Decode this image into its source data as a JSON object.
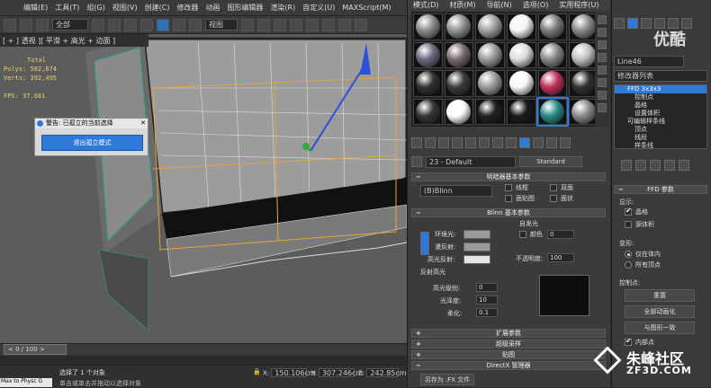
{
  "menu": {
    "logo": "3",
    "items": [
      "编辑(E)",
      "工具(T)",
      "组(G)",
      "视图(V)",
      "创建(C)",
      "修改器",
      "动画",
      "图形编辑器",
      "渲染(R)",
      "自定义(U)",
      "MAXScript(M)"
    ]
  },
  "toolbar": {
    "filter": "全部",
    "viewref": "视图"
  },
  "viewport": {
    "label": "[ + ] 透视 ][ 平滑 + 高光 + 边面 ]"
  },
  "stats": {
    "total": "Total",
    "polys": "Polys: 582,674",
    "verts": "Verts: 392,495",
    "fps": "FPS: 37.681"
  },
  "warning": {
    "title": "警告: 已孤立的当前选择",
    "button": "退出孤立模式"
  },
  "timeline": {
    "frame": "0 / 100"
  },
  "status": {
    "script": "Max to Physc G",
    "selected": "选择了 1 个对象",
    "hint": "单击或单击并拖动以选择对象",
    "x": "150.106cm",
    "y": "307.246cm",
    "z": "242.85cm"
  },
  "material_editor": {
    "menu": [
      "模式(D)",
      "材质(M)",
      "导航(N)",
      "选项(O)",
      "实用程序(U)"
    ],
    "name": "23 - Default",
    "type": "Standard",
    "shader_roll": "明暗器基本参数",
    "shader": "(B)Blinn",
    "shader_opts": [
      "线框",
      "双面",
      "面贴图",
      "面状"
    ],
    "blinn_roll": "Blinn 基本参数",
    "self_illum": "自发光",
    "color_label": "颜色",
    "color_val": "0",
    "ambient": "环境光:",
    "diffuse": "漫反射:",
    "specular": "高光反射:",
    "opacity_label": "不透明度:",
    "opacity": "100",
    "spec_hl": "反射高光",
    "spec_level_label": "高光级别:",
    "spec_level": "0",
    "gloss_label": "光泽度:",
    "gloss": "10",
    "soften_label": "柔化:",
    "soften": "0.1",
    "rollouts": [
      "扩展参数",
      "超级采样",
      "贴图",
      "DirectX 管理器"
    ],
    "save_fx": "另存为 .FX 文件",
    "sphere_colors": [
      "#8a8a8a",
      "#909090",
      "#a0a0a0",
      "#f4f4f4",
      "#7a7a7a",
      "#888888",
      "#6a6a80",
      "#7a6a70",
      "#9a9a9a",
      "#dddddd",
      "#888888",
      "#c0c0c0",
      "#303030",
      "#3a3a3a",
      "#9a9a9a",
      "#f8f8f8",
      "#c0305a",
      "#303030",
      "#353535",
      "#ffffff",
      "#202020",
      "#1a1a1a",
      "#2a8a8a",
      "#8a8a8a"
    ]
  },
  "cmd": {
    "object_name": "Line46",
    "modifier_list": "修改器列表",
    "stack": [
      "FFD 3x3x3",
      "控制点",
      "晶格",
      "设置体积",
      "可编辑样条线",
      "顶点",
      "线段",
      "样条线"
    ],
    "ffd_roll": "FFD 参数",
    "display": "显示:",
    "lattice": "晶格",
    "source_volume": "源体积",
    "deform": "变形:",
    "only_in_vol": "仅在体内",
    "all_vertices": "所有顶点",
    "control_points": "控制点:",
    "reset": "重置",
    "animate_all": "全部动画化",
    "conform": "与图形一致",
    "inside_points": "内部点"
  },
  "watermark": {
    "brand": "优酷",
    "site": "朱峰社区",
    "url": "ZF3D.COM"
  },
  "colors": {
    "accent": "#2f79d9",
    "stats": "#e7d36a",
    "panel": "#3b3b3b"
  }
}
